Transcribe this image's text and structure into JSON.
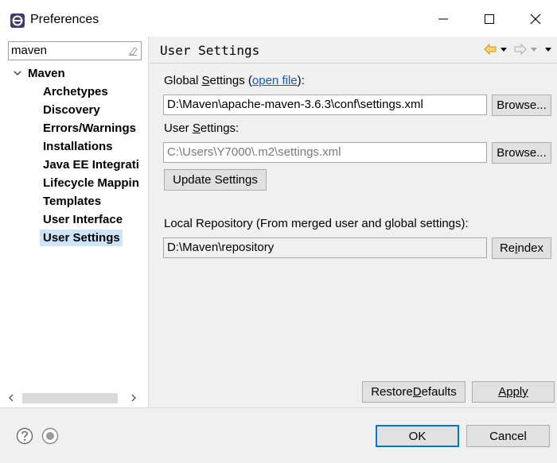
{
  "window": {
    "title": "Preferences"
  },
  "filter": {
    "value": "maven"
  },
  "tree": {
    "root": "Maven",
    "items": [
      "Archetypes",
      "Discovery",
      "Errors/Warnings",
      "Installations",
      "Java EE Integrati",
      "Lifecycle Mappin",
      "Templates",
      "User Interface",
      "User Settings"
    ],
    "selected": "User Settings"
  },
  "page": {
    "title": "User Settings",
    "global_settings_prefix": "Global ",
    "global_settings_key": "S",
    "global_settings_rest": "ettings (",
    "open_file": "open file",
    "global_settings_suffix": "):",
    "global_settings_value": "D:\\Maven\\apache-maven-3.6.3\\conf\\settings.xml",
    "browse_label": "Browse...",
    "user_settings_prefix": "User ",
    "user_settings_key": "S",
    "user_settings_rest": "ettings:",
    "user_settings_value": "C:\\Users\\Y7000\\.m2\\settings.xml",
    "update_settings": "Update Settings",
    "local_repo_label": "Local Repository (From merged user and global settings):",
    "local_repo_value": "D:\\Maven\\repository",
    "reindex_pre": "Re",
    "reindex_key": "i",
    "reindex_post": "ndex",
    "restore_pre": "Restore ",
    "restore_key": "D",
    "restore_post": "efaults",
    "apply_label": "Apply"
  },
  "footer": {
    "ok": "OK",
    "cancel": "Cancel"
  },
  "colors": {
    "selection": "#cce4f7",
    "link": "#1a5bb3",
    "ok_border": "#0078d7"
  }
}
